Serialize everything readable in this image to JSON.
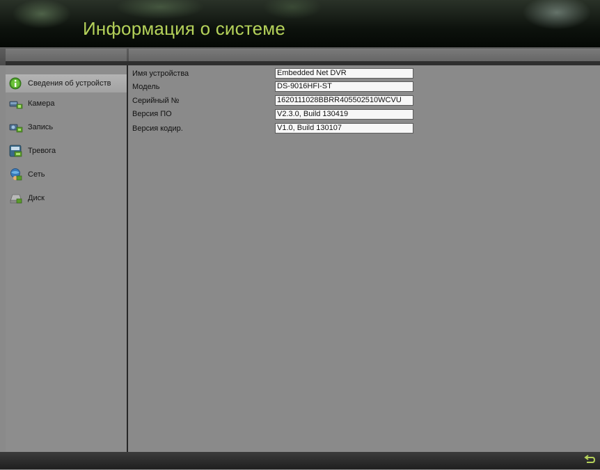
{
  "header": {
    "title": "Информация о системе"
  },
  "sidebar": {
    "items": [
      {
        "label": "Сведения об устройств",
        "icon": "info-icon",
        "active": true
      },
      {
        "label": "Камера",
        "icon": "camera-icon",
        "active": false
      },
      {
        "label": "Запись",
        "icon": "record-icon",
        "active": false
      },
      {
        "label": "Тревога",
        "icon": "alarm-icon",
        "active": false
      },
      {
        "label": "Сеть",
        "icon": "network-icon",
        "active": false
      },
      {
        "label": "Диск",
        "icon": "disk-icon",
        "active": false
      }
    ]
  },
  "device_info": {
    "fields": [
      {
        "label": "Имя устройства",
        "value": "Embedded Net DVR"
      },
      {
        "label": "Модель",
        "value": "DS-9016HFI-ST"
      },
      {
        "label": "Серийный №",
        "value": "1620111028BBRR405502510WCVU"
      },
      {
        "label": "Версия ПО",
        "value": "V2.3.0, Build 130419"
      },
      {
        "label": "Версия кодир.",
        "value": "V1.0, Build 130107"
      }
    ]
  },
  "footer": {
    "back_icon": "back-arrow-icon"
  },
  "colors": {
    "title": "#b5d25a",
    "panel_bg": "#8a8a8a",
    "active_item": "#b4b4b4"
  }
}
